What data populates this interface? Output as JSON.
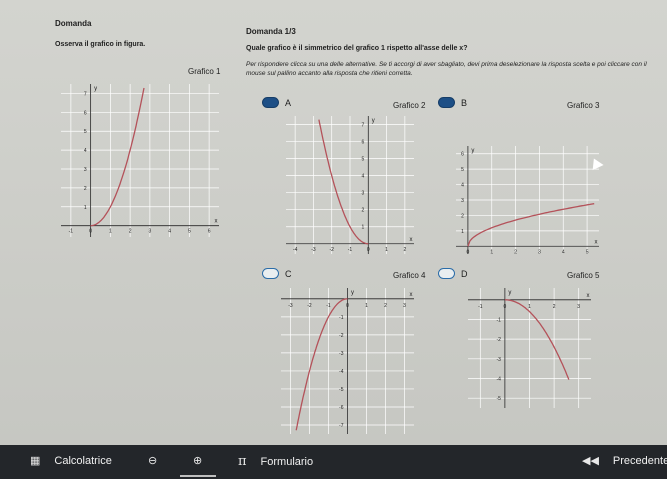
{
  "left": {
    "heading": "Domanda",
    "instruction": "Osserva il grafico in figura.",
    "graph_caption": "Grafico 1"
  },
  "right": {
    "heading": "Domanda 1/3",
    "question": "Quale grafico è il simmetrico del grafico 1 rispetto all'asse delle x?",
    "instructions": "Per rispondere clicca su una delle alternative. Se ti accorgi di aver sbagliato, devi prima deselezionare la risposta scelta e poi cliccare con il mouse sul pallino accanto alla risposta che ritieni corretta."
  },
  "options": [
    {
      "letter": "A",
      "caption": "Grafico 2",
      "selected": true
    },
    {
      "letter": "B",
      "caption": "Grafico 3",
      "selected": false
    },
    {
      "letter": "C",
      "caption": "Grafico 4",
      "selected": false
    },
    {
      "letter": "D",
      "caption": "Grafico 5",
      "selected": false
    }
  ],
  "footer": {
    "calculator_label": "Calcolatrice",
    "formulary_label": "Formulario",
    "previous_label": "Precedente",
    "pi_symbol": "π"
  },
  "graphs": {
    "g1": {
      "xticks": [
        "-1",
        "0",
        "1",
        "2",
        "3",
        "4",
        "5",
        "6"
      ],
      "yticks": [
        "1",
        "2",
        "3",
        "4",
        "5",
        "6",
        "7"
      ],
      "xlabel": "x",
      "ylabel": "y"
    },
    "g2": {
      "xticks": [
        "-4",
        "-3",
        "-2",
        "-1",
        "0",
        "1",
        "2"
      ],
      "yticks": [
        "1",
        "2",
        "3",
        "4",
        "5",
        "6",
        "7"
      ],
      "xlabel": "x",
      "ylabel": "y"
    },
    "g3": {
      "xticks": [
        "0",
        "1",
        "2",
        "3",
        "4",
        "5"
      ],
      "yticks": [
        "1",
        "2",
        "3",
        "4",
        "5",
        "6"
      ],
      "xlabel": "x",
      "ylabel": "y"
    },
    "g4": {
      "xticks": [
        "-3",
        "-2",
        "-1",
        "0",
        "1",
        "2",
        "3"
      ],
      "yticks": [
        "-1",
        "-2",
        "-3",
        "-4",
        "-5",
        "-6",
        "-7"
      ],
      "xlabel": "x",
      "ylabel": "y"
    },
    "g5": {
      "xticks": [
        "-1",
        "0",
        "1",
        "2",
        "3"
      ],
      "yticks": [
        "-1",
        "-2",
        "-3",
        "-4",
        "-5"
      ],
      "xlabel": "x",
      "ylabel": "y"
    }
  }
}
